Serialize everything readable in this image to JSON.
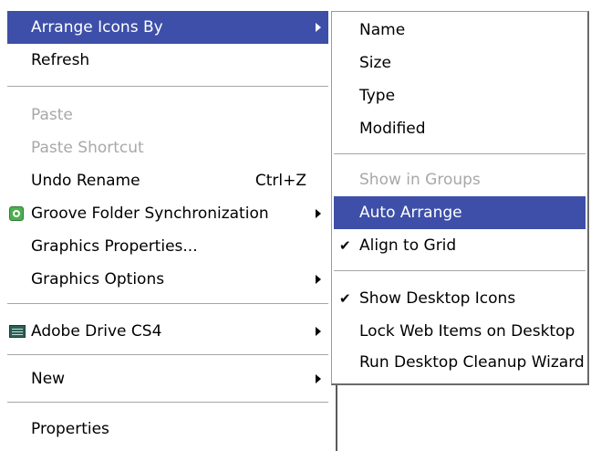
{
  "context_menu": {
    "items": [
      {
        "label": "Arrange Icons By",
        "has_submenu": true,
        "state": "highlighted"
      },
      {
        "label": "Refresh"
      },
      {
        "label": "Paste",
        "state": "disabled"
      },
      {
        "label": "Paste Shortcut",
        "state": "disabled"
      },
      {
        "label": "Undo Rename",
        "shortcut": "Ctrl+Z"
      },
      {
        "label": "Groove Folder Synchronization",
        "has_submenu": true,
        "icon": "groove-icon"
      },
      {
        "label": "Graphics Properties..."
      },
      {
        "label": "Graphics Options",
        "has_submenu": true
      },
      {
        "label": "Adobe Drive CS4",
        "has_submenu": true,
        "icon": "adobe-drive-icon"
      },
      {
        "label": "New",
        "has_submenu": true
      },
      {
        "label": "Properties"
      }
    ]
  },
  "arrange_submenu": {
    "items": [
      {
        "label": "Name"
      },
      {
        "label": "Size"
      },
      {
        "label": "Type"
      },
      {
        "label": "Modified"
      },
      {
        "label": "Show in Groups",
        "state": "disabled"
      },
      {
        "label": "Auto Arrange",
        "state": "highlighted"
      },
      {
        "label": "Align to Grid",
        "checked": true
      },
      {
        "label": "Show Desktop Icons",
        "checked": true
      },
      {
        "label": "Lock Web Items on Desktop"
      },
      {
        "label": "Run Desktop Cleanup Wizard"
      }
    ],
    "check_glyph": "✔"
  },
  "colors": {
    "highlight": "#3d4fa8",
    "disabled_text": "#a8a8a8"
  }
}
